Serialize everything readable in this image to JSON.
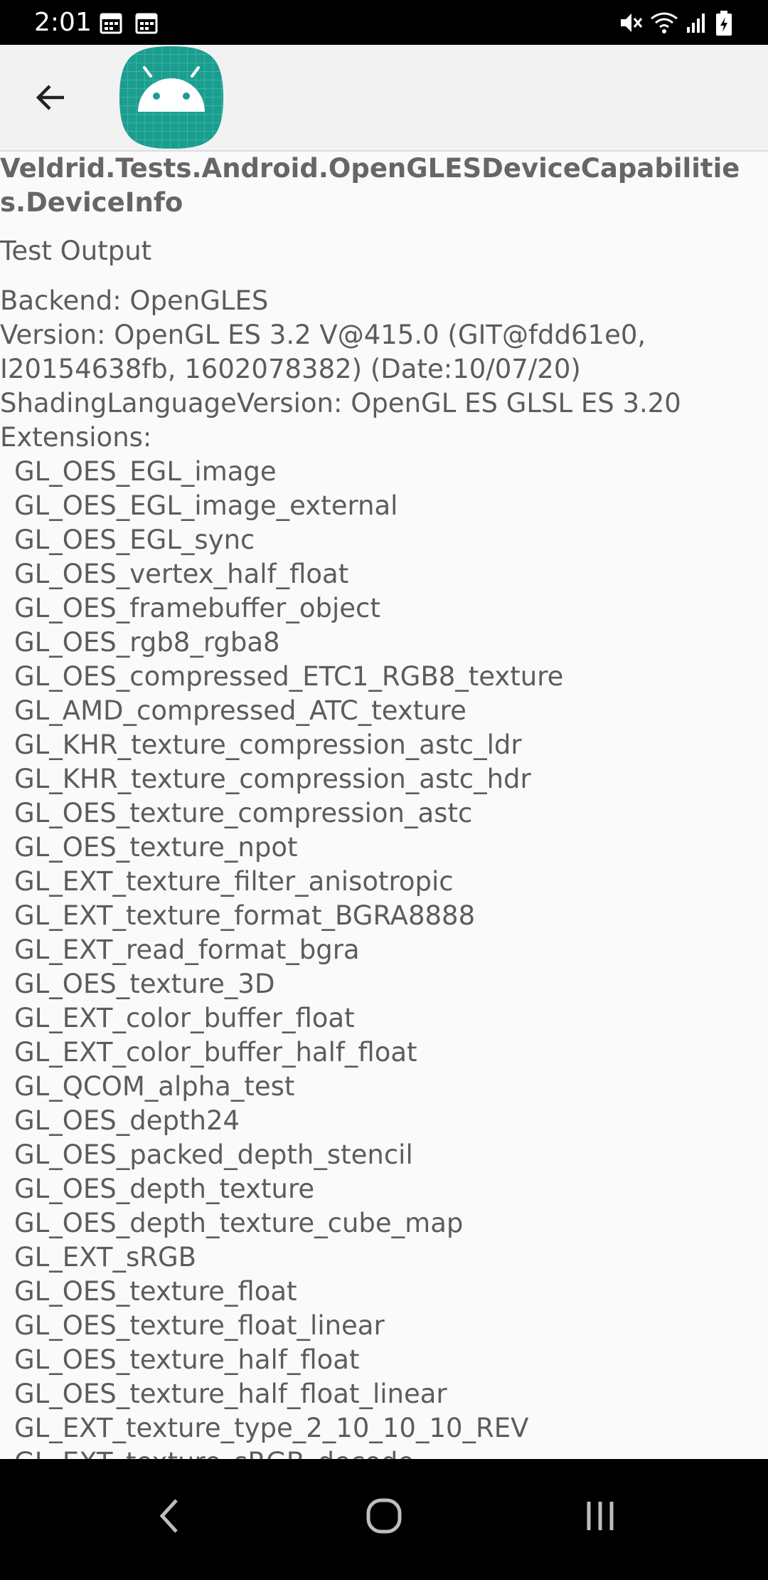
{
  "status_bar": {
    "time": "2:01",
    "left_icons": [
      "calendar-icon",
      "calendar-icon"
    ],
    "right_icons": [
      "mute-icon",
      "wifi-icon",
      "signal-icon",
      "battery-charging-icon"
    ]
  },
  "app_bar": {
    "back_icon": "arrow-left-icon",
    "logo_icon": "android-robot-icon",
    "logo_color": "#1b9e8f"
  },
  "content": {
    "title": "Veldrid.Tests.Android.OpenGLESDeviceCapabilities.DeviceInfo",
    "section_label": "Test Output",
    "backend": "Backend: OpenGLES",
    "version_line1": "Version: OpenGL ES 3.2 V@415.0 (GIT@fdd61e0,",
    "version_line2": "I20154638fb, 1602078382) (Date:10/07/20)",
    "shading": "ShadingLanguageVersion: OpenGL ES GLSL ES 3.20",
    "extensions_label": "Extensions:",
    "extensions": [
      "GL_OES_EGL_image",
      "GL_OES_EGL_image_external",
      "GL_OES_EGL_sync",
      "GL_OES_vertex_half_float",
      "GL_OES_framebuffer_object",
      "GL_OES_rgb8_rgba8",
      "GL_OES_compressed_ETC1_RGB8_texture",
      "GL_AMD_compressed_ATC_texture",
      "GL_KHR_texture_compression_astc_ldr",
      "GL_KHR_texture_compression_astc_hdr",
      "GL_OES_texture_compression_astc",
      "GL_OES_texture_npot",
      "GL_EXT_texture_filter_anisotropic",
      "GL_EXT_texture_format_BGRA8888",
      "GL_EXT_read_format_bgra",
      "GL_OES_texture_3D",
      "GL_EXT_color_buffer_float",
      "GL_EXT_color_buffer_half_float",
      "GL_QCOM_alpha_test",
      "GL_OES_depth24",
      "GL_OES_packed_depth_stencil",
      "GL_OES_depth_texture",
      "GL_OES_depth_texture_cube_map",
      "GL_EXT_sRGB",
      "GL_OES_texture_float",
      "GL_OES_texture_float_linear",
      "GL_OES_texture_half_float",
      "GL_OES_texture_half_float_linear",
      "GL_EXT_texture_type_2_10_10_10_REV",
      "GL_EXT_texture_sRGB_decode"
    ]
  },
  "nav_bar": {
    "buttons": [
      "back-nav-icon",
      "home-nav-icon",
      "recents-nav-icon"
    ]
  }
}
